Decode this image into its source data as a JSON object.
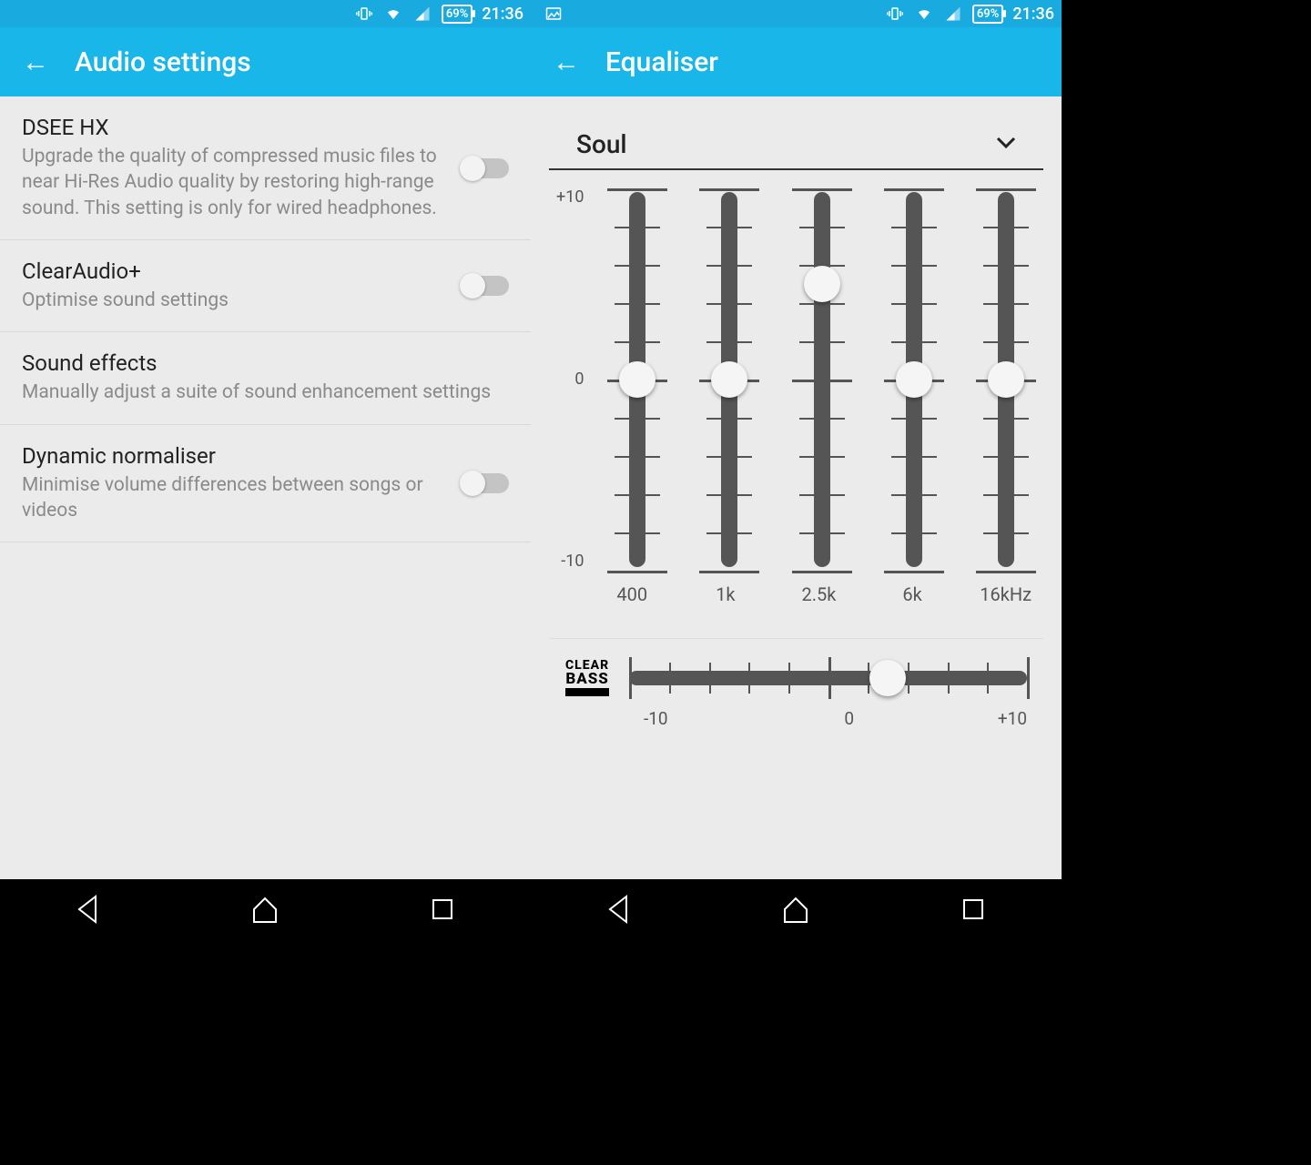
{
  "status": {
    "battery": "69%",
    "time": "21:36"
  },
  "left": {
    "title": "Audio settings",
    "items": [
      {
        "title": "DSEE HX",
        "desc": "Upgrade the quality of compressed music files to near Hi-Res Audio quality by restoring high-range sound. This setting is only for wired headphones.",
        "toggle": true
      },
      {
        "title": "ClearAudio+",
        "desc": "Optimise sound settings",
        "toggle": true
      },
      {
        "title": "Sound effects",
        "desc": "Manually adjust a suite of sound enhancement settings",
        "toggle": false
      },
      {
        "title": "Dynamic normaliser",
        "desc": "Minimise volume differences between songs or videos",
        "toggle": true
      }
    ]
  },
  "right": {
    "title": "Equaliser",
    "preset": "Soul",
    "ylabels": {
      "top": "+10",
      "mid": "0",
      "bot": "-10"
    },
    "bands": [
      {
        "freq": "400",
        "value": 0
      },
      {
        "freq": "1k",
        "value": 0
      },
      {
        "freq": "2.5k",
        "value": 5
      },
      {
        "freq": "6k",
        "value": 0
      },
      {
        "freq": "16kHz",
        "value": 0
      }
    ],
    "clearbass": {
      "label_top": "CLEAR",
      "label_bot": "BASS",
      "min": "-10",
      "mid": "0",
      "max": "+10",
      "value": 3
    }
  }
}
